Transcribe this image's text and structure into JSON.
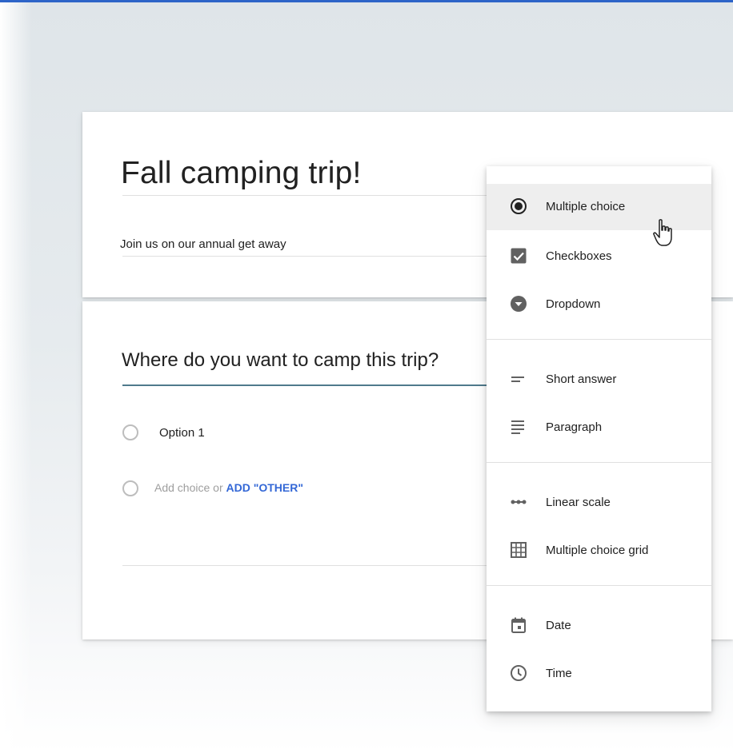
{
  "form": {
    "title": "Fall camping trip!",
    "description": "Join us on our annual get away"
  },
  "question": {
    "title": "Where do you want to camp this trip?",
    "option_1": "Option 1",
    "add_choice": "Add choice or",
    "add_other": "ADD \"OTHER\""
  },
  "menu": {
    "items": [
      {
        "label": "Multiple choice",
        "icon": "radio-checked-icon"
      },
      {
        "label": "Checkboxes",
        "icon": "checkbox-icon"
      },
      {
        "label": "Dropdown",
        "icon": "dropdown-icon"
      },
      {
        "label": "Short answer",
        "icon": "short-text-icon"
      },
      {
        "label": "Paragraph",
        "icon": "paragraph-icon"
      },
      {
        "label": "Linear scale",
        "icon": "linear-scale-icon"
      },
      {
        "label": "Multiple choice grid",
        "icon": "grid-icon"
      },
      {
        "label": "Date",
        "icon": "calendar-icon"
      },
      {
        "label": "Time",
        "icon": "clock-icon"
      }
    ],
    "hovered": "Multiple choice"
  },
  "colors": {
    "accent_bar": "#2d64c8",
    "link": "#3367d6",
    "question_underline": "#4f7a8c",
    "icon": "#616161"
  }
}
